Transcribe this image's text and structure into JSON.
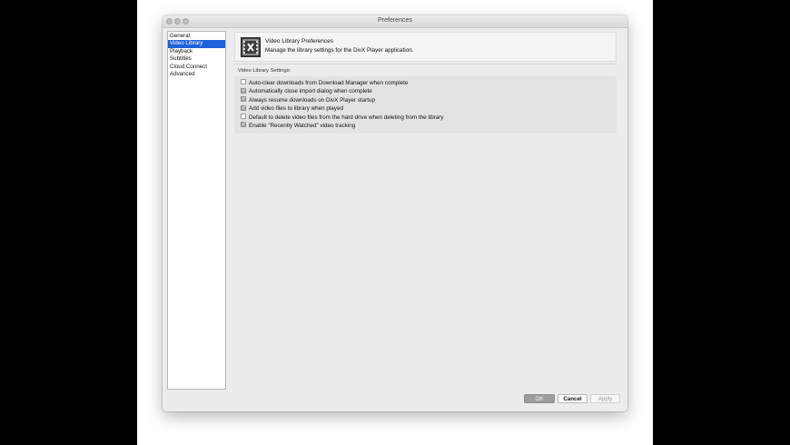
{
  "window": {
    "title": "Preferences"
  },
  "sidebar": {
    "items": [
      {
        "label": "General",
        "selected": false
      },
      {
        "label": "Video Library",
        "selected": true
      },
      {
        "label": "Playback",
        "selected": false
      },
      {
        "label": "Subtitles",
        "selected": false
      },
      {
        "label": "Cloud Connect",
        "selected": false
      },
      {
        "label": "Advanced",
        "selected": false
      }
    ]
  },
  "header": {
    "icon": "video-library-icon",
    "title": "Video Library Preferences",
    "description": "Manage the library settings for the DivX Player application."
  },
  "settings": {
    "label": "Video Library Settings:",
    "options": [
      {
        "label": "Auto-clear downloads from Download Manager when complete",
        "checked": false
      },
      {
        "label": "Automatically close import dialog when complete",
        "checked": true
      },
      {
        "label": "Always resume downloads on DivX Player startup",
        "checked": true
      },
      {
        "label": "Add video files to library when played",
        "checked": true
      },
      {
        "label": "Default to delete video files from the hard drive when deleting from the library",
        "checked": false
      },
      {
        "label": "Enable \"Recently Watched\" video tracking",
        "checked": true
      }
    ]
  },
  "buttons": {
    "ok": "OK",
    "cancel": "Cancel",
    "apply": "Apply"
  },
  "colors": {
    "selection": "#1d62d8",
    "window_bg": "#ececec"
  }
}
